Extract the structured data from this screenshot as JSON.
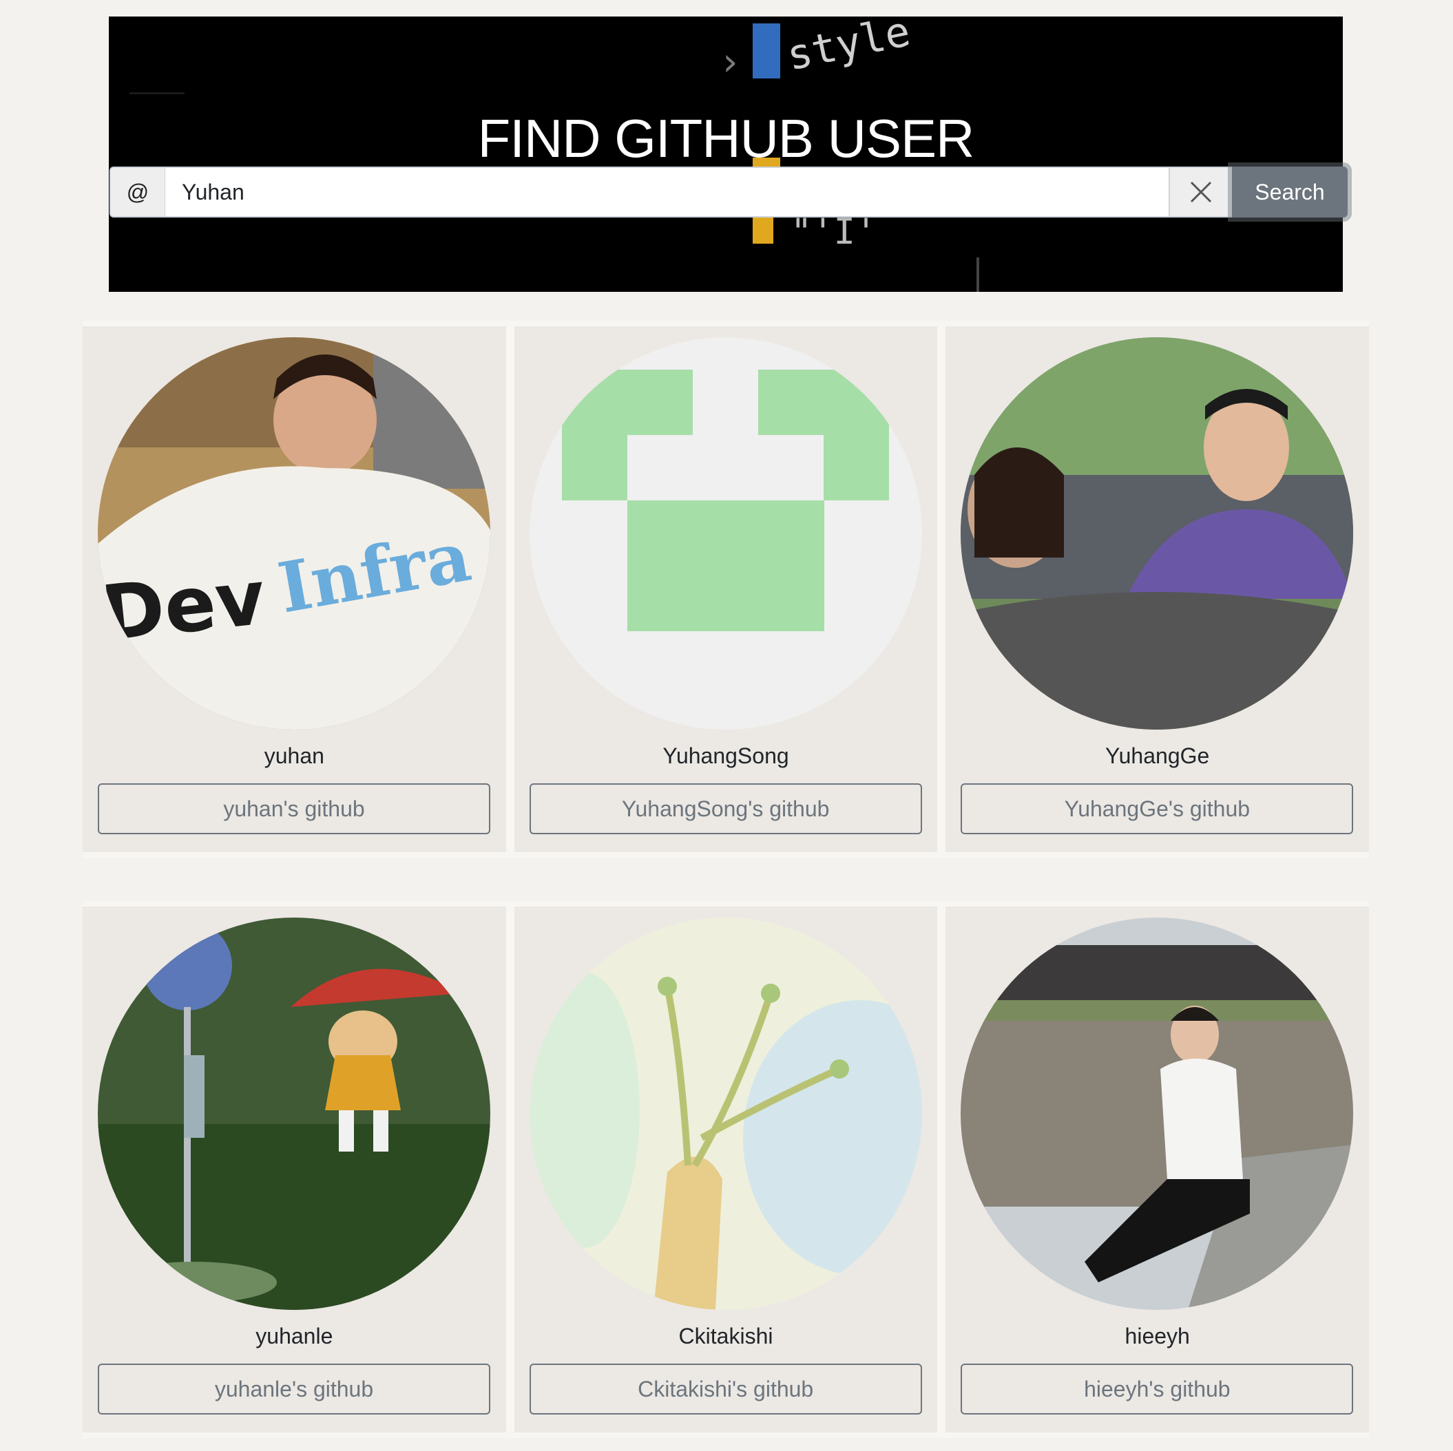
{
  "header": {
    "title": "FIND GITHUB USER"
  },
  "search": {
    "prefix": "@",
    "value": "Yuhan",
    "button_label": "Search"
  },
  "users": [
    {
      "username": "yuhan",
      "link_label": "yuhan's github"
    },
    {
      "username": "YuhangSong",
      "link_label": "YuhangSong's github"
    },
    {
      "username": "YuhangGe",
      "link_label": "YuhangGe's github"
    },
    {
      "username": "yuhanle",
      "link_label": "yuhanle's github"
    },
    {
      "username": "Ckitakishi",
      "link_label": "Ckitakishi's github"
    },
    {
      "username": "hieeyh",
      "link_label": "hieeyh's github"
    }
  ],
  "colors": {
    "page_bg": "#f3f2ee",
    "card_bg": "#ece8e4",
    "search_button": "#6c757d",
    "identicon_green": "#a6dea8"
  }
}
